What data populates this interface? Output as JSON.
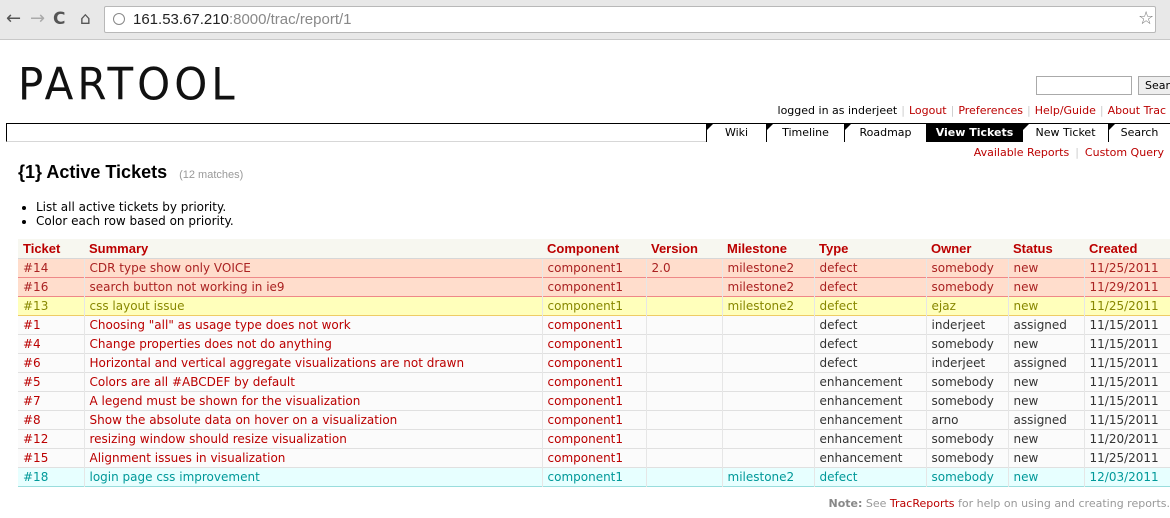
{
  "browser": {
    "url_host": "161.53.67.210",
    "url_rest": ":8000/trac/report/1",
    "icons": [
      "back-arrow-icon",
      "forward-arrow-icon",
      "reload-icon",
      "home-icon",
      "globe-icon",
      "star-icon"
    ]
  },
  "header": {
    "logo": "PARTOOL",
    "search_button": "Search",
    "metanav": {
      "logged_in": "logged in as inderjeet",
      "items": [
        "Logout",
        "Preferences",
        "Help/Guide",
        "About Trac"
      ]
    }
  },
  "mainnav": {
    "tabs": [
      "Wiki",
      "Timeline",
      "Roadmap",
      "View Tickets",
      "New Ticket",
      "Search"
    ],
    "active": "View Tickets"
  },
  "ctxtnav": {
    "items": [
      "Available Reports",
      "Custom Query"
    ]
  },
  "report": {
    "title": "{1} Active Tickets",
    "matches": "(12 matches)",
    "description": [
      "List all active tickets by priority.",
      "Color each row based on priority."
    ],
    "columns": [
      "Ticket",
      "Summary",
      "Component",
      "Version",
      "Milestone",
      "Type",
      "Owner",
      "Status",
      "Created"
    ],
    "rows": [
      {
        "priority": "p1",
        "ticket": "#14",
        "summary": "CDR type show only VOICE",
        "component": "component1",
        "version": "2.0",
        "milestone": "milestone2",
        "type": "defect",
        "owner": "somebody",
        "status": "new",
        "created": "11/25/2011"
      },
      {
        "priority": "p1",
        "ticket": "#16",
        "summary": "search button not working in ie9",
        "component": "component1",
        "version": "",
        "milestone": "milestone2",
        "type": "defect",
        "owner": "somebody",
        "status": "new",
        "created": "11/29/2011"
      },
      {
        "priority": "p2",
        "ticket": "#13",
        "summary": "css layout issue",
        "component": "component1",
        "version": "",
        "milestone": "milestone2",
        "type": "defect",
        "owner": "ejaz",
        "status": "new",
        "created": "11/25/2011"
      },
      {
        "priority": "p3",
        "ticket": "#1",
        "summary": "Choosing \"all\" as usage type does not work",
        "component": "component1",
        "version": "",
        "milestone": "",
        "type": "defect",
        "owner": "inderjeet",
        "status": "assigned",
        "created": "11/15/2011"
      },
      {
        "priority": "p3",
        "ticket": "#4",
        "summary": "Change properties does not do anything",
        "component": "component1",
        "version": "",
        "milestone": "",
        "type": "defect",
        "owner": "somebody",
        "status": "new",
        "created": "11/15/2011"
      },
      {
        "priority": "p3",
        "ticket": "#6",
        "summary": "Horizontal and vertical aggregate visualizations are not drawn",
        "component": "component1",
        "version": "",
        "milestone": "",
        "type": "defect",
        "owner": "inderjeet",
        "status": "assigned",
        "created": "11/15/2011"
      },
      {
        "priority": "p3",
        "ticket": "#5",
        "summary": "Colors are all #ABCDEF by default",
        "component": "component1",
        "version": "",
        "milestone": "",
        "type": "enhancement",
        "owner": "somebody",
        "status": "new",
        "created": "11/15/2011"
      },
      {
        "priority": "p3",
        "ticket": "#7",
        "summary": "A legend must be shown for the visualization",
        "component": "component1",
        "version": "",
        "milestone": "",
        "type": "enhancement",
        "owner": "somebody",
        "status": "new",
        "created": "11/15/2011"
      },
      {
        "priority": "p3",
        "ticket": "#8",
        "summary": "Show the absolute data on hover on a visualization",
        "component": "component1",
        "version": "",
        "milestone": "",
        "type": "enhancement",
        "owner": "arno",
        "status": "assigned",
        "created": "11/15/2011"
      },
      {
        "priority": "p3",
        "ticket": "#12",
        "summary": "resizing window should resize visualization",
        "component": "component1",
        "version": "",
        "milestone": "",
        "type": "enhancement",
        "owner": "somebody",
        "status": "new",
        "created": "11/20/2011"
      },
      {
        "priority": "p3",
        "ticket": "#15",
        "summary": "Alignment issues in visualization",
        "component": "component1",
        "version": "",
        "milestone": "",
        "type": "enhancement",
        "owner": "somebody",
        "status": "new",
        "created": "11/25/2011"
      },
      {
        "priority": "p4",
        "ticket": "#18",
        "summary": "login page css improvement",
        "component": "component1",
        "version": "",
        "milestone": "milestone2",
        "type": "defect",
        "owner": "somebody",
        "status": "new",
        "created": "12/03/2011"
      }
    ]
  },
  "note": {
    "label": "Note:",
    "before": "See",
    "link": "TracReports",
    "after": "for help on using and creating reports."
  }
}
